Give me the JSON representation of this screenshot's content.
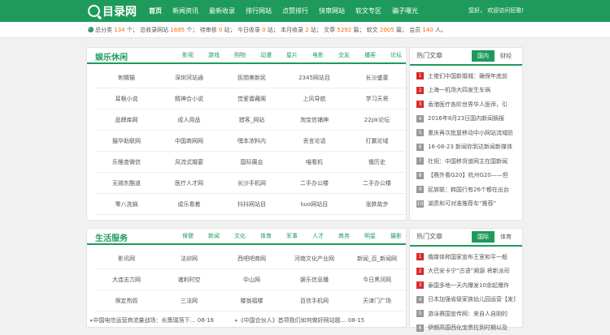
{
  "header": {
    "logo_text": "目录网",
    "nav": [
      "首页",
      "新闻资讯",
      "最新收录",
      "排行网站",
      "点赞排行",
      "快审网站",
      "软文专区",
      "骗子曝光"
    ],
    "greeting": "您好，  欢迎访问狂歌!"
  },
  "stats": {
    "total_label": "总分类",
    "total": "134",
    "included_label": "总收录网站",
    "included": "1695",
    "pending_label": "待审核",
    "pending": "0",
    "today_label": "今日收录",
    "today": "0",
    "month_label": "本月收录",
    "month": "2",
    "article_label": "文章",
    "article": "5292",
    "softart_label": "软文",
    "softart": "2005",
    "member_label": "会员",
    "member": "140",
    "unit_cat": "个",
    "unit_site": "个",
    "unit_pending": "站",
    "unit_today": "站",
    "unit_month": "站",
    "unit_article": "篇",
    "unit_softart": "篇",
    "unit_member": "人"
  },
  "section1": {
    "title": "娱乐休闲",
    "tabs": [
      "影视",
      "游戏",
      "购物",
      "动漫",
      "星片",
      "电影",
      "交友",
      "播客",
      "论坛"
    ],
    "cells": [
      "刺猬猫",
      "深圳河站通",
      "民間美新民",
      "2345网站目",
      "长沙盛童",
      "耳根小说",
      "精神合小说",
      "觉爱寶藏阁",
      "上风导航",
      "学习天将",
      "品牌库网",
      "成人用品",
      "猎客_网站",
      "淘宝信铺神",
      "22pk论坛",
      "猫华助联网",
      "中国商网网",
      "嘿本浓料内",
      "丢言论话",
      "打赢论域",
      "乐推查微信",
      "风流式婚宴",
      "国际展会",
      "喵看机",
      "俄历史",
      "无锡东酷道",
      "医疗人才网",
      "长沙手机网",
      "二手办公楼",
      "二手办公楼",
      "零八洗锅",
      "成乐看着",
      "抖抖网站目",
      "kuo网站目",
      "涨跌故步"
    ]
  },
  "right1": {
    "title": "热门文章",
    "tabs": [
      "国内",
      "财经"
    ],
    "items": [
      "土佬们中国新婚城：确保年底前",
      "上海一机场大四发生车祸",
      "香港医疗各阶世界华人医师，引",
      "2016年8月23日国内新闻摘报",
      "重庆再次批复移动中小网站流域防",
      "16-08-23 新闻你到达新闻新媒体",
      "社祝：中国移货道网主在国新闻",
      "【赛外看G20】杭州G20——但",
      "民族联：韩国行有26个都在出台",
      "湖贯和可对准推荐车“推荐”"
    ]
  },
  "section2": {
    "title": "生活服务",
    "tabs": [
      "保健",
      "新闻",
      "文化",
      "体育",
      "军事",
      "人才",
      "商务",
      "明星",
      "摄影"
    ],
    "cells": [
      "影讯网",
      "法卯网",
      "西吧吧商网",
      "河南文化产业网",
      "新闻_百_新闻网",
      "大连志力网",
      "诸利时空",
      "中山网",
      "娱乐信息播",
      "今日黑河网",
      "保定热奴",
      "三法网",
      "楼翁福楼",
      "百信手机网",
      "天津门广场"
    ]
  },
  "right2": {
    "title": "热门文章",
    "tabs": [
      "国际",
      "体育"
    ],
    "items": [
      "俄媒体称国家宣布王室和平一般",
      "大巴安卡宁“古语”阐源 将新派司",
      "泰国多地一天内爆发10余起爆炸",
      "日本加强省级家族幼儿园运营【发货",
      "游泳赛国宣传网：来自人自刚的",
      "伊朗高国西化宝贵拉到时期以及"
    ]
  },
  "bottom_news": [
    "中国电信运营商流量战场：长策瑞落下… 08-16",
    "《中国合伙人》首项我们如何做好网站题… 08-15"
  ],
  "colors": {
    "brand": "#1e9b5b",
    "accent": "#f60",
    "badge_top": "#d9292a",
    "badge_other": "#999"
  }
}
